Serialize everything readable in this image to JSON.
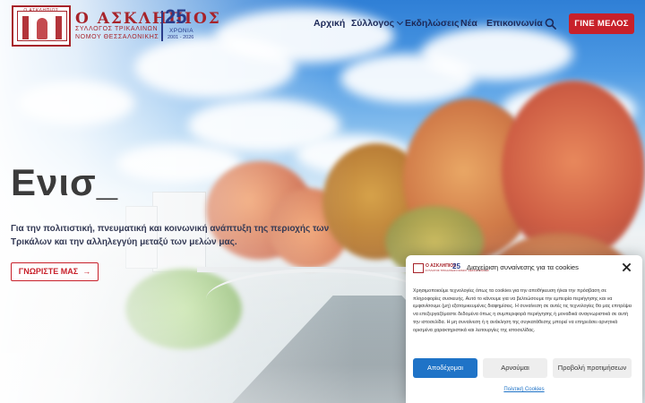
{
  "brand": {
    "name": "Ο ΑΣΚΛΗΠΙΟΣ",
    "subtitle_line1": "ΣΥΛΛΟΓΟΣ ΤΡΙΚΑΛΙΝΩΝ",
    "subtitle_line2": "ΝΟΜΟΥ ΘΕΣΣΑΛΟΝΙΚΗΣ",
    "anniversary_number": "25",
    "anniversary_word": "ΧΡΟΝΙΑ",
    "anniversary_years": "2001 - 2026",
    "primary_color": "#a7232a",
    "secondary_color": "#2a3d8a"
  },
  "nav": {
    "items": [
      {
        "label": "Αρχική",
        "active": true
      },
      {
        "label": "Σύλλογος",
        "has_dropdown": true
      },
      {
        "label": "Εκδηλώσεις"
      },
      {
        "label": "Νέα"
      },
      {
        "label": "Επικοινωνία"
      }
    ],
    "search_icon": "search-icon",
    "cta_label": "ΓΙΝΕ ΜΕΛΟΣ",
    "cta_color": "#c8202a"
  },
  "hero": {
    "title": "Ενισ_",
    "text": "Για την πολιτιστική, πνευματική και κοινωνική ανάπτυξη της περιοχής των Τρικάλων και την αλληλεγγύη μεταξύ των μελών μας.",
    "button_label": "ΓΝΩΡΙΣΤΕ ΜΑΣ",
    "button_icon": "arrow-right-icon"
  },
  "cookie_banner": {
    "title": "Διαχείριση συναίνεσης για τα cookies",
    "logo_name": "Ο ΑΣΚΛΗΠΙΟΣ",
    "logo_subtitle": "ΣΥΛΛΟΓΟΣ ΤΡΙΚΑΛΙΝΩΝ ΝΟΜΟΥ ΘΕΣΣΑΛΟΝΙΚΗΣ",
    "logo_number": "25",
    "body": "Χρησιμοποιούμε τεχνολογίες όπως τα cookies για την αποθήκευση ή/και την πρόσβαση σε πληροφορίες συσκευής. Αυτό το κάνουμε για να βελτιώσουμε την εμπειρία περιήγησης και να εμφανίσουμε (μη) εξατομικευμένες διαφημίσεις. Η συναίνεση σε αυτές τις τεχνολογίες θα μας επιτρέψει να επεξεργαζόμαστε δεδομένα όπως η συμπεριφορά περιήγησης ή μοναδικά αναγνωριστικά σε αυτή την ιστοσελίδα. Η μη συναίνεση ή η ανάκληση της συγκατάθεσης μπορεί να επηρεάσει αρνητικά ορισμένα χαρακτηριστικά και λειτουργίες της ιστοσελίδας.",
    "accept_label": "Αποδέχομαι",
    "deny_label": "Αρνούμαι",
    "prefs_label": "Προβολή προτιμήσεων",
    "policy_link": "Πολιτική Cookies",
    "accept_color": "#1f73c7"
  }
}
